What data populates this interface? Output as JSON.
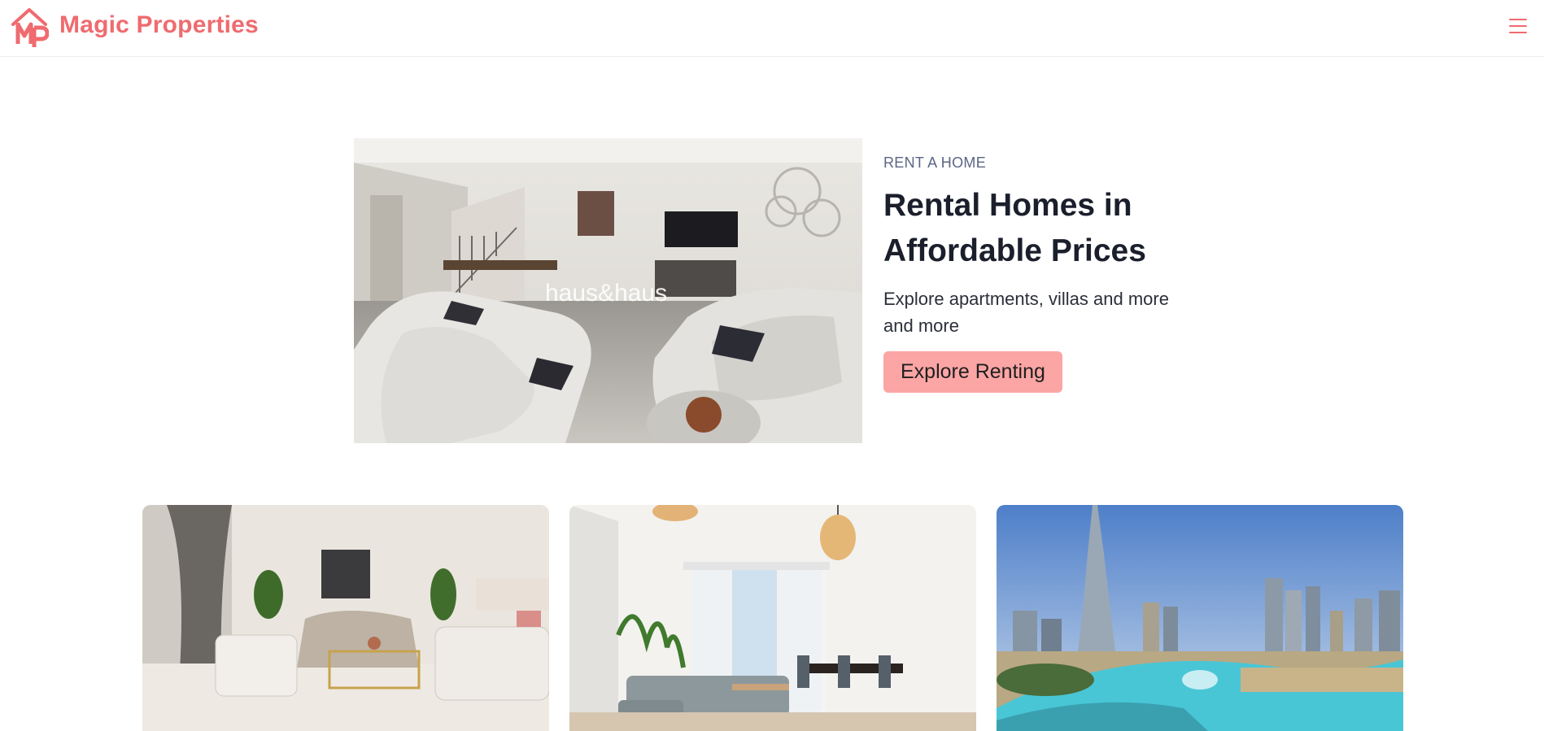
{
  "header": {
    "brand": "Magic Properties",
    "logo_icon": "house-mp-logo-icon",
    "menu_icon": "hamburger-menu-icon",
    "accent_color": "#ef6b6f"
  },
  "hero": {
    "eyebrow": "RENT A HOME",
    "title": "Rental Homes in Affordable Prices",
    "subtitle": "Explore apartments, villas and more and more",
    "cta_label": "Explore Renting",
    "cta_color": "#fca5a5",
    "image_watermark": "haus&haus"
  },
  "cards": [
    {
      "image": "living-room-beige-sofas-photo"
    },
    {
      "image": "bright-living-dining-room-photo"
    },
    {
      "image": "dubai-skyline-fountain-photo"
    }
  ]
}
